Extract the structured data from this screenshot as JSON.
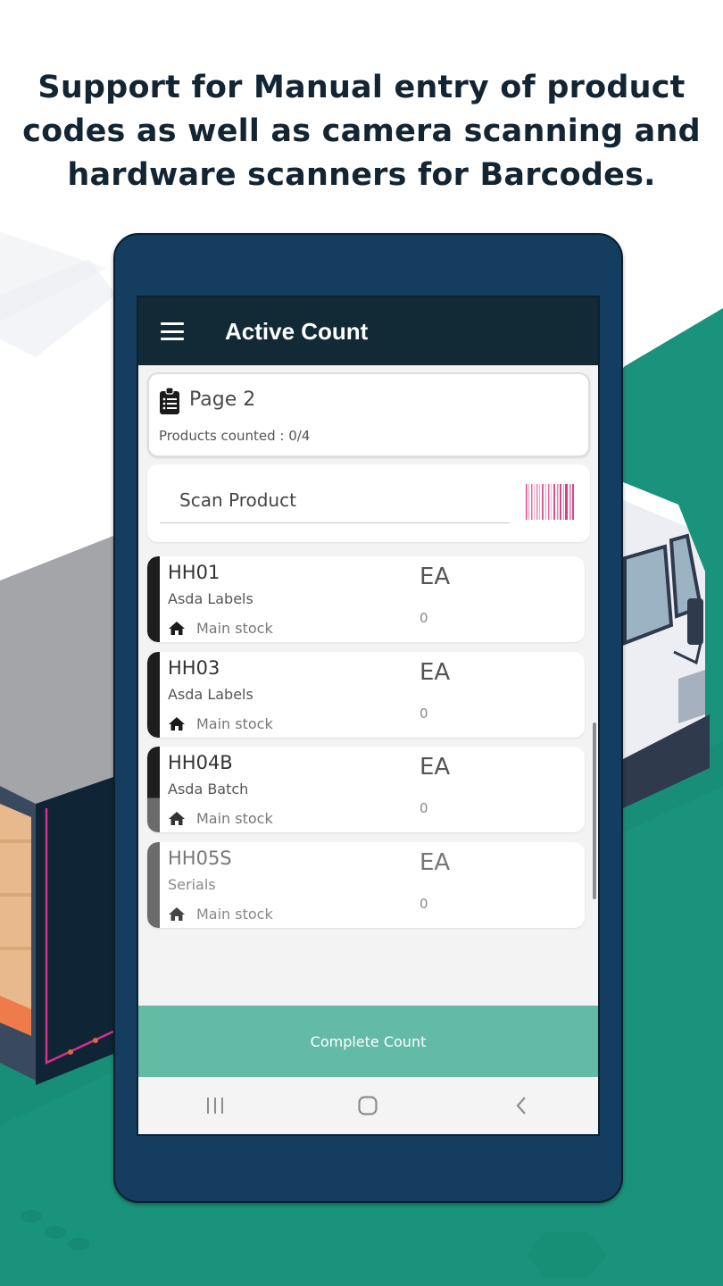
{
  "headline": {
    "lines": [
      "Support for Manual entry of product",
      "codes as well as camera scanning and",
      "hardware scanners for Barcodes."
    ]
  },
  "app": {
    "title": "Active Count",
    "menu_icon": "hamburger-menu-icon",
    "page_card": {
      "icon": "clipboard-list-icon",
      "title": "Page 2",
      "subtitle": "Products counted : 0/4"
    },
    "scan": {
      "placeholder": "Scan Product",
      "value": "",
      "button_icon": "barcode-icon",
      "barcode_color": "#d6327f"
    },
    "items": [
      {
        "code": "HH01",
        "description": "Asda Labels",
        "location": "Main stock",
        "location_icon": "home-icon",
        "uom": "EA",
        "quantity": "0",
        "accent": "#1e1e1e"
      },
      {
        "code": "HH03",
        "description": "Asda Labels",
        "location": "Main stock",
        "location_icon": "home-icon",
        "uom": "EA",
        "quantity": "0",
        "accent": "#1e1e1e"
      },
      {
        "code": "HH04B",
        "description": "Asda Batch",
        "location": "Main stock",
        "location_icon": "home-icon",
        "uom": "EA",
        "quantity": "0",
        "accent": "#1e1e1e"
      },
      {
        "code": "HH05S",
        "description": "Serials",
        "location": "Main stock",
        "location_icon": "home-icon",
        "uom": "EA",
        "quantity": "0",
        "accent": "#6b6b6b"
      }
    ],
    "complete_button": "Complete Count",
    "nav": {
      "recents_icon": "recent-apps-icon",
      "home_icon": "home-button-icon",
      "back_icon": "back-icon"
    }
  },
  "colors": {
    "appbar": "#112a36",
    "phone_frame": "#143d5f",
    "complete_button": "#63bba6",
    "background_green": "#1a937c"
  }
}
